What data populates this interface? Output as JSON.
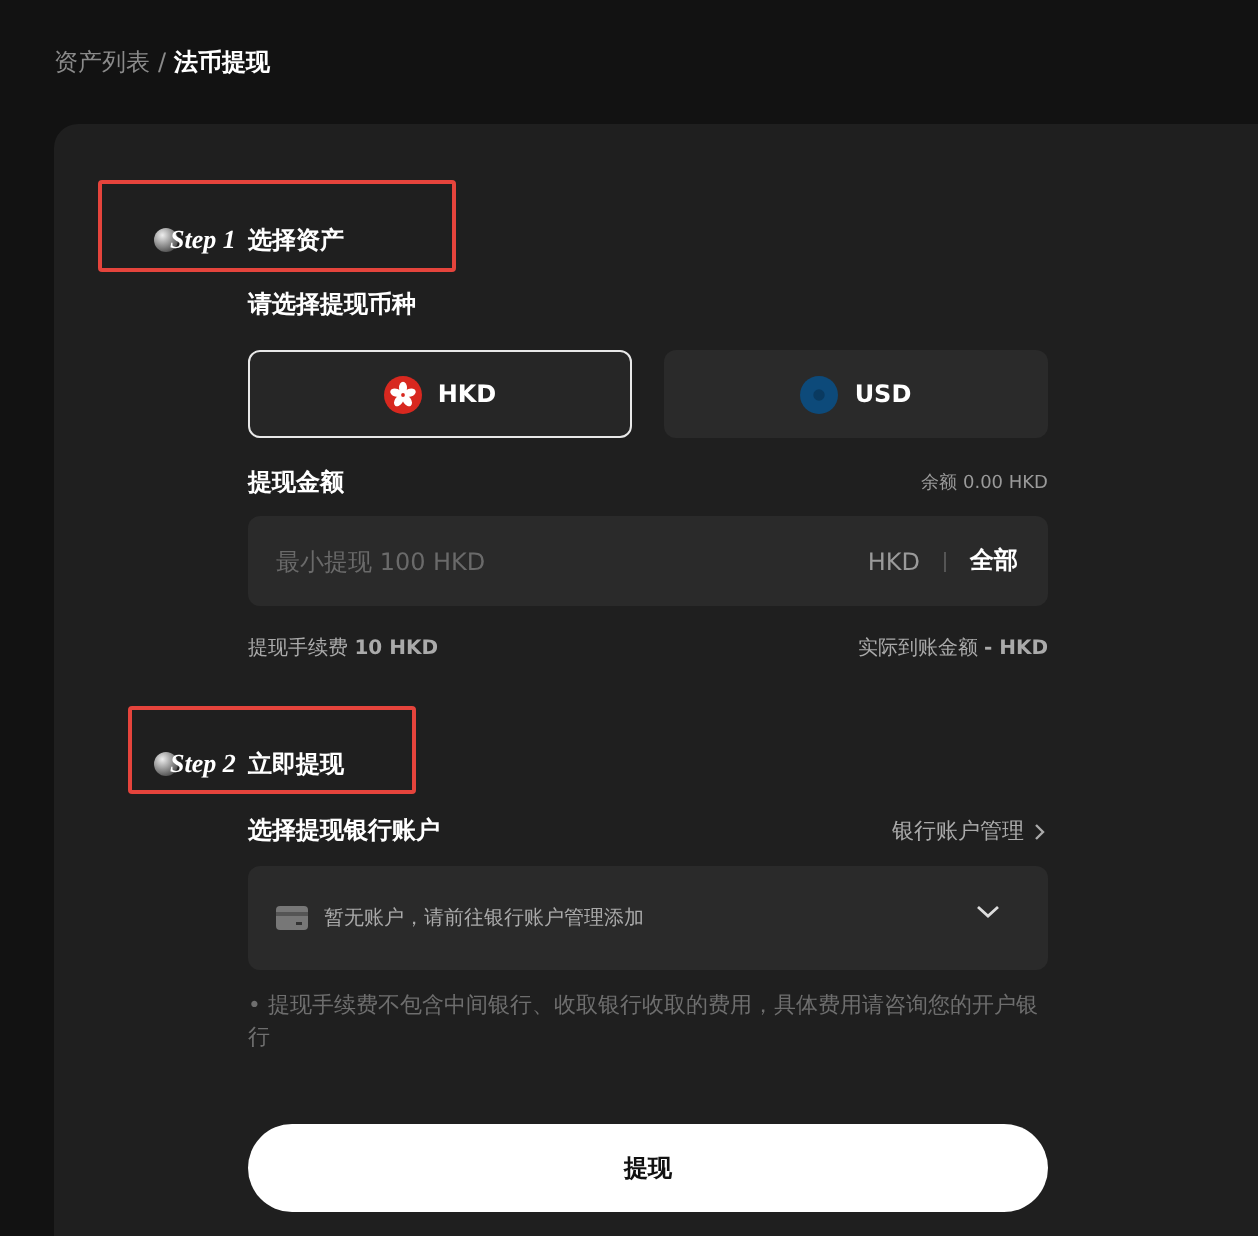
{
  "breadcrumb": [
    {
      "label": "资产列表",
      "current": false
    },
    {
      "label": "法币提现",
      "current": true
    }
  ],
  "breadcrumb_separator": "/",
  "steps": [
    {
      "tag": "Step 1",
      "title": "选择资产"
    },
    {
      "tag": "Step 2",
      "title": "立即提现"
    }
  ],
  "currency_section": {
    "label": "请选择提现币种"
  },
  "currencies": [
    {
      "code": "HKD",
      "selected": true,
      "kind": "hkd"
    },
    {
      "code": "USD",
      "selected": false,
      "kind": "usd"
    }
  ],
  "amount": {
    "label": "提现金额",
    "balance": "余额 0.00 HKD",
    "placeholder": "最小提现 100 HKD",
    "unit": "HKD",
    "all_button": "全部"
  },
  "fee": "提现手续费 **10 HKD**",
  "received": "实际到账金额 **- HKD**",
  "bank": {
    "label": "选择提现银行账户",
    "manage_link": "银行账户管理",
    "select_placeholder": "暂无账户，请前往银行账户管理添加"
  },
  "note": "• 提现手续费不包含中间银行、收取银行收取的费用，具体费用请咨询您的开户银行",
  "submit_button": "提现"
}
